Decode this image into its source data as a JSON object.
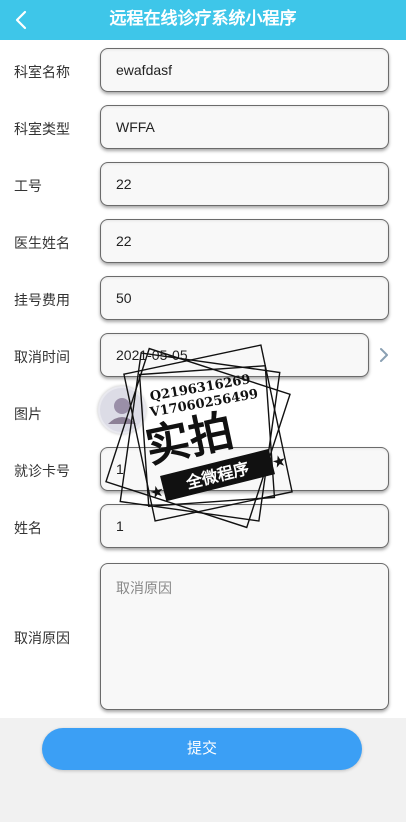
{
  "header": {
    "title": "远程在线诊疗系统小程序",
    "back_icon": "chevron-left-icon"
  },
  "form": {
    "fields": [
      {
        "label": "科室名称",
        "value": "ewafdasf"
      },
      {
        "label": "科室类型",
        "value": "WFFA"
      },
      {
        "label": "工号",
        "value": "22"
      },
      {
        "label": "医生姓名",
        "value": "22"
      },
      {
        "label": "挂号费用",
        "value": "50"
      },
      {
        "label": "取消时间",
        "value": "2021-05-05"
      },
      {
        "label": "图片",
        "value": ""
      },
      {
        "label": "就诊卡号",
        "value": "1"
      },
      {
        "label": "姓名",
        "value": "1"
      },
      {
        "label": "取消原因",
        "placeholder": "取消原因"
      }
    ]
  },
  "submit_label": "提交",
  "watermark": {
    "line1": "Q2196316269",
    "line2": "V17060256499",
    "main": "实拍",
    "banner": "全微程序"
  },
  "colors": {
    "header": "#3ec6e9",
    "button": "#3b9ff5"
  }
}
